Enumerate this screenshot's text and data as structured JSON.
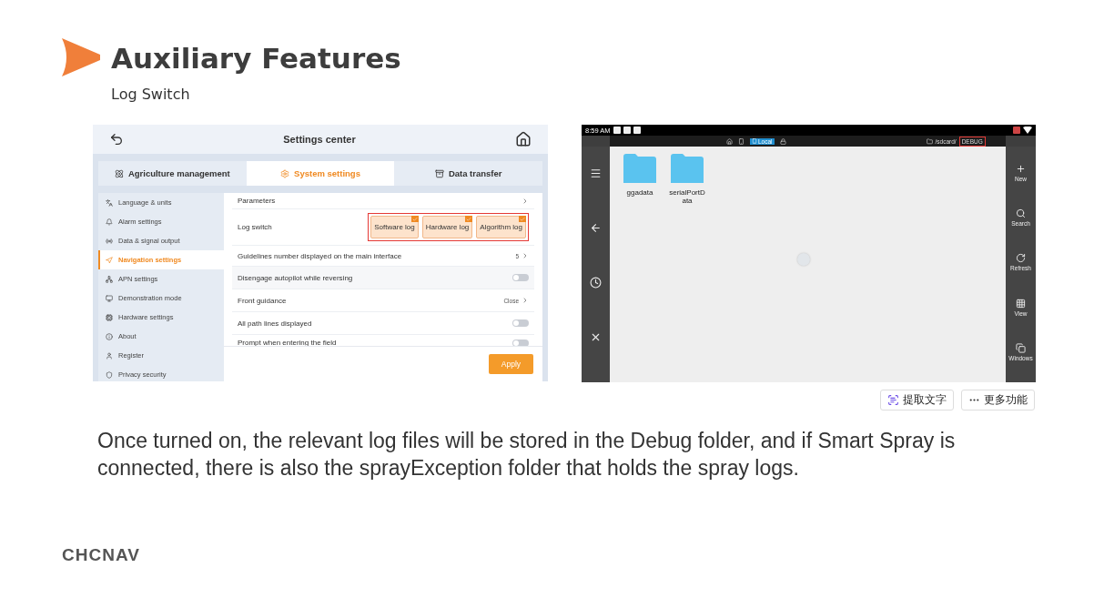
{
  "slide": {
    "title": "Auxiliary Features",
    "subtitle": "Log Switch",
    "body": "Once turned on, the relevant log files will be stored in the Debug folder, and if Smart Spray is connected, there is also the sprayException folder that holds the spray logs.",
    "logo": "CHCNAV"
  },
  "settings_screen": {
    "title": "Settings center",
    "tabs": [
      {
        "label": "Agriculture management",
        "selected": false
      },
      {
        "label": "System settings",
        "selected": true
      },
      {
        "label": "Data transfer",
        "selected": false
      }
    ],
    "sidebar": [
      {
        "label": "Language & units",
        "selected": false
      },
      {
        "label": "Alarm settings",
        "selected": false
      },
      {
        "label": "Data & signal output",
        "selected": false
      },
      {
        "label": "Navigation settings",
        "selected": true
      },
      {
        "label": "APN settings",
        "selected": false
      },
      {
        "label": "Demonstration mode",
        "selected": false
      },
      {
        "label": "Hardware settings",
        "selected": false
      },
      {
        "label": "About",
        "selected": false
      },
      {
        "label": "Register",
        "selected": false
      },
      {
        "label": "Privacy security",
        "selected": false
      }
    ],
    "rows": [
      {
        "kind": "link",
        "label": "Parameters"
      },
      {
        "kind": "chips",
        "label": "Log switch",
        "highlighted": true,
        "chips": [
          {
            "label": "Software log",
            "checked": true
          },
          {
            "label": "Hardware log",
            "checked": true
          },
          {
            "label": "Algorithm log",
            "checked": true
          }
        ]
      },
      {
        "kind": "link",
        "label": "Guidelines number displayed on the main interface",
        "value": "5"
      },
      {
        "kind": "toggle",
        "label": "Disengage autopilot while reversing",
        "on": false
      },
      {
        "kind": "link",
        "label": "Front guidance",
        "value": "Close"
      },
      {
        "kind": "toggle",
        "label": "All path lines displayed",
        "on": false
      },
      {
        "kind": "toggle",
        "label": "Prompt when entering the field",
        "on": false
      }
    ],
    "apply_button": "Apply"
  },
  "file_screen": {
    "time": "8:59 AM",
    "storage_tab": "Local",
    "path": "/sdcard/",
    "path_highlight": "DEBUG",
    "folders": [
      {
        "name": "ggadata"
      },
      {
        "name": "serialPortData"
      }
    ],
    "actions": [
      {
        "label": "New"
      },
      {
        "label": "Search"
      },
      {
        "label": "Refresh"
      },
      {
        "label": "View"
      },
      {
        "label": "Windows"
      }
    ]
  },
  "viewer_buttons": [
    {
      "label": "提取文字"
    },
    {
      "label": "更多功能"
    }
  ]
}
